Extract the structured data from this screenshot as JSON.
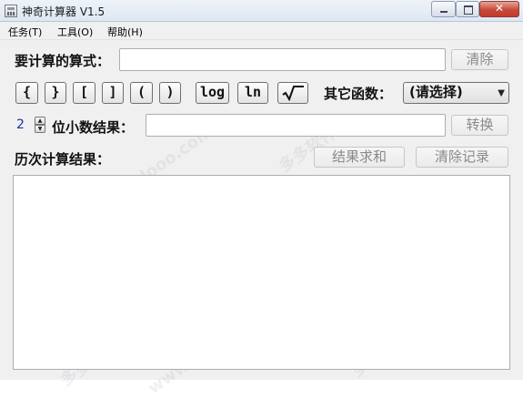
{
  "window": {
    "title": "神奇计算器 V1.5",
    "close_symbol": "✕"
  },
  "menu": {
    "items": [
      "任务(T)",
      "工具(O)",
      "帮助(H)"
    ]
  },
  "formula": {
    "label": "要计算的算式：",
    "value": "",
    "clear_label": "清除"
  },
  "keys": {
    "brace_open": "{",
    "brace_close": "}",
    "bracket_open": "[",
    "bracket_close": "]",
    "paren_open": "(",
    "paren_close": ")",
    "log": "log",
    "ln": "ln",
    "sqrt": "√‾"
  },
  "functions": {
    "label": "其它函数：",
    "selected": "(请选择)"
  },
  "decimal": {
    "value": "2",
    "label": "位小数结果：",
    "result": "",
    "convert_label": "转换"
  },
  "history": {
    "label": "历次计算结果：",
    "sum_label": "结果求和",
    "clear_label": "清除记录",
    "entries": []
  },
  "watermark": {
    "text": "www.ddooo.com",
    "cn_text": "多多软件站"
  }
}
